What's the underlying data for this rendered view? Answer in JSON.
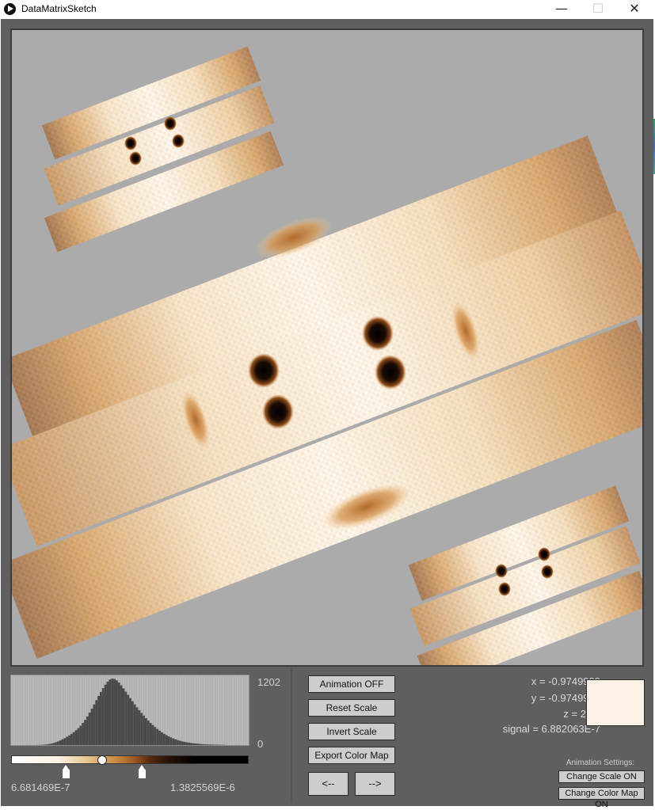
{
  "window": {
    "title": "DataMatrixSketch",
    "minimize_glyph": "—",
    "maximize_glyph": "☐",
    "close_glyph": "✕"
  },
  "histogram": {
    "max_label": "1202",
    "min_label": "0",
    "bins": [
      2,
      3,
      5,
      8,
      12,
      18,
      26,
      36,
      50,
      66,
      84,
      104,
      126,
      150,
      176,
      204,
      234,
      268,
      306,
      350,
      400,
      456,
      518,
      586,
      658,
      734,
      812,
      888,
      960,
      1030,
      1092,
      1146,
      1186,
      1202,
      1196,
      1170,
      1130,
      1080,
      1024,
      966,
      908,
      850,
      792,
      736,
      682,
      630,
      580,
      532,
      486,
      442,
      400,
      362,
      326,
      292,
      260,
      230,
      204,
      180,
      158,
      138,
      120,
      104,
      90,
      78,
      68,
      58,
      50,
      44,
      38,
      33,
      28,
      24,
      20,
      17,
      14,
      12,
      10,
      9,
      8,
      7,
      6,
      5,
      4,
      3
    ]
  },
  "color_scale": {
    "min_label": "6.681469E-7",
    "max_label": "1.3825569E-6",
    "knob_fraction": 0.38,
    "lower_handle_fraction": 0.23,
    "upper_handle_fraction": 0.55
  },
  "buttons": {
    "animation": "Animation OFF",
    "reset_scale": "Reset Scale",
    "invert_scale": "Invert Scale",
    "export_color_map": "Export Color Map",
    "prev": "<--",
    "next": "-->"
  },
  "readout": {
    "x": "x = -0.9749999",
    "y": "y = -0.9749999",
    "z": "z = 25.5",
    "signal": "signal = 6.882063E-7",
    "swatch_color": "#fbf1e4"
  },
  "animation_settings": {
    "label": "Animation Settings:",
    "change_scale": "Change Scale ON",
    "change_color_map": "Change Color Map ON"
  },
  "colors": {
    "viewer_bg": "#ababab",
    "panel_bg": "#5f5f5f",
    "map_light": "#fdf6ec",
    "map_mid": "#c98a42",
    "map_dark": "#3a1a06"
  },
  "viewer": {
    "data_plot_label": "data-matrix-plot"
  }
}
